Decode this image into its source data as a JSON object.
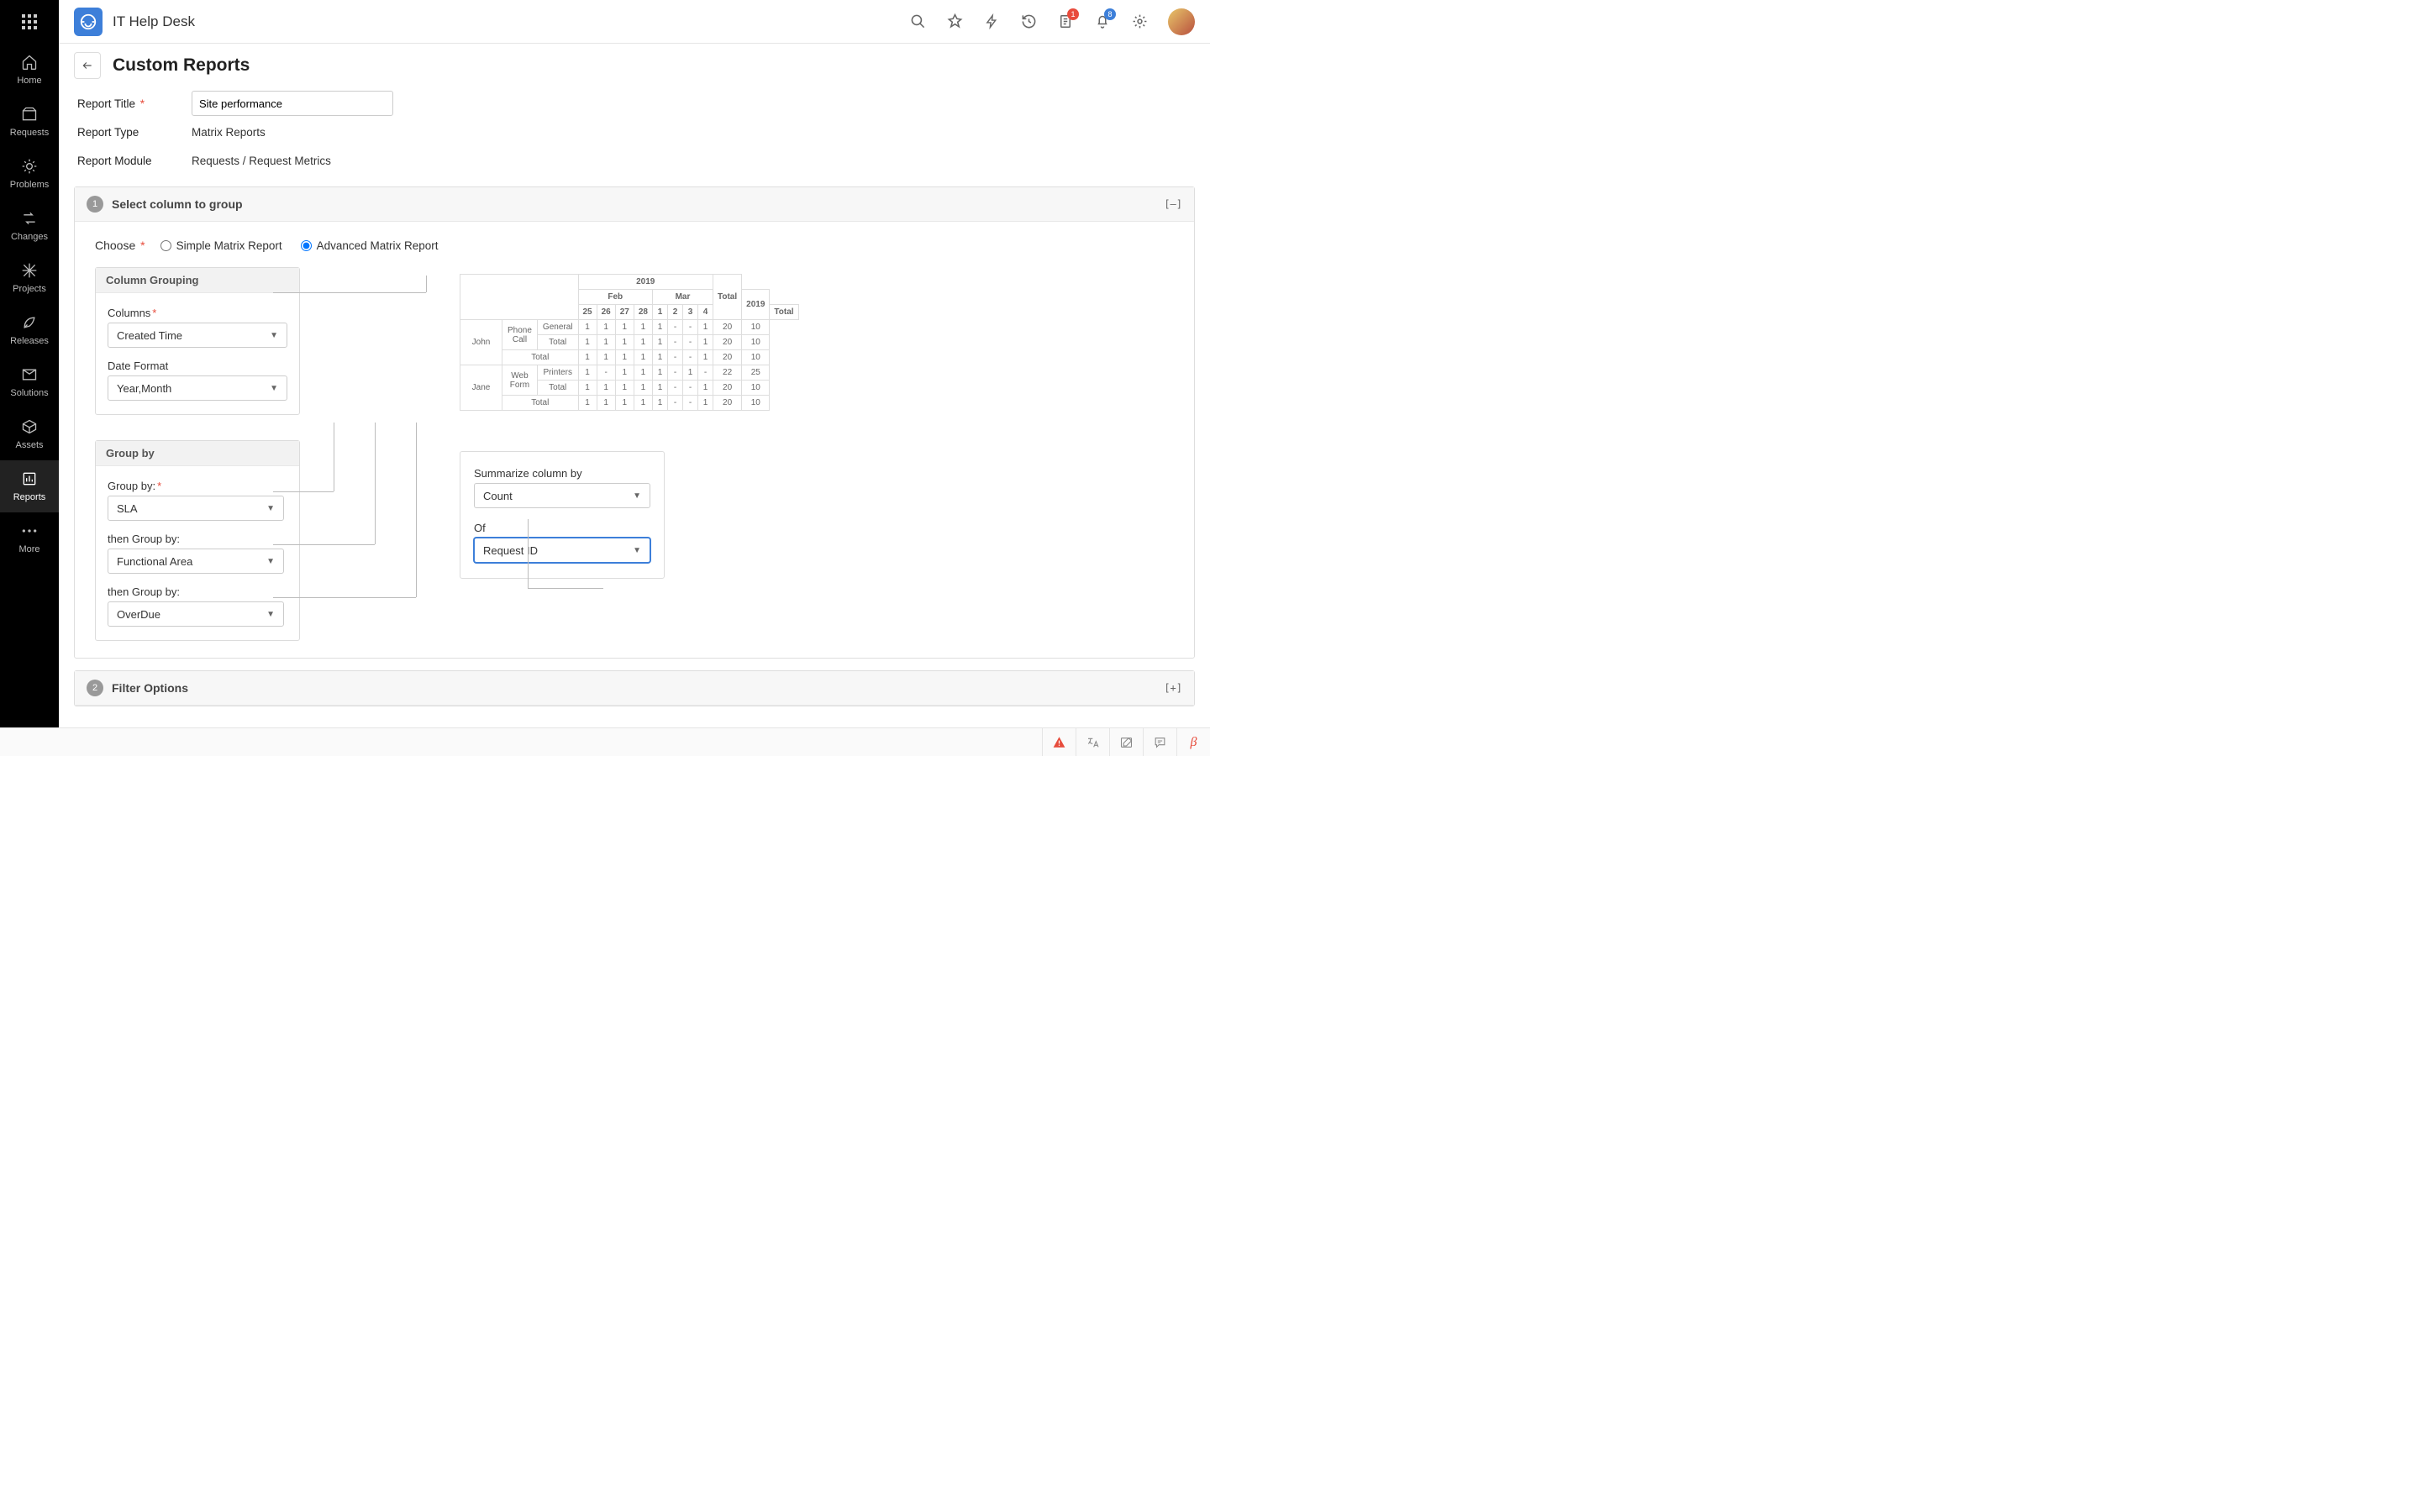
{
  "app": {
    "title": "IT Help Desk"
  },
  "nav": {
    "items": [
      {
        "label": "Home"
      },
      {
        "label": "Requests"
      },
      {
        "label": "Problems"
      },
      {
        "label": "Changes"
      },
      {
        "label": "Projects"
      },
      {
        "label": "Releases"
      },
      {
        "label": "Solutions"
      },
      {
        "label": "Assets"
      },
      {
        "label": "Reports"
      },
      {
        "label": "More"
      }
    ]
  },
  "topbar": {
    "clipboard_badge": "1",
    "bell_badge": "8"
  },
  "page": {
    "title": "Custom Reports",
    "report_title_label": "Report Title",
    "report_title_value": "Site performance",
    "report_type_label": "Report Type",
    "report_type_value": "Matrix Reports",
    "report_module_label": "Report Module",
    "report_module_value": "Requests / Request Metrics"
  },
  "section1": {
    "step": "1",
    "title": "Select column to group",
    "toggle": "[–]",
    "choose_label": "Choose",
    "radio_simple": "Simple Matrix Report",
    "radio_advanced": "Advanced Matrix Report",
    "column_grouping": {
      "header": "Column Grouping",
      "columns_label": "Columns",
      "columns_value": "Created Time",
      "date_format_label": "Date Format",
      "date_format_value": "Year,Month"
    },
    "group_by": {
      "header": "Group by",
      "label1": "Group by:",
      "value1": "SLA",
      "label2": "then Group by:",
      "value2": "Functional Area",
      "label3": "then Group by:",
      "value3": "OverDue"
    },
    "summarize": {
      "label1": "Summarize column by",
      "value1": "Count",
      "label2": "Of",
      "value2": "Request ID"
    },
    "preview": {
      "year": "2019",
      "total": "Total",
      "months": [
        "Feb",
        "Mar",
        "2019"
      ],
      "feb_days": [
        "25",
        "26",
        "27",
        "28"
      ],
      "mar_days": [
        "1",
        "2",
        "3",
        "4"
      ],
      "col_total": "Total",
      "rows": [
        {
          "g1": "John",
          "g2": "Phone Call",
          "g3": "General",
          "cells": [
            "1",
            "1",
            "1",
            "1",
            "1",
            "-",
            "-",
            "1",
            "20",
            "10"
          ]
        },
        {
          "g1": "",
          "g2": "",
          "g3": "Total",
          "cells": [
            "1",
            "1",
            "1",
            "1",
            "1",
            "-",
            "-",
            "1",
            "20",
            "10"
          ]
        },
        {
          "g1": "",
          "g2": "Total",
          "g3": "",
          "cells": [
            "1",
            "1",
            "1",
            "1",
            "1",
            "-",
            "-",
            "1",
            "20",
            "10"
          ]
        },
        {
          "g1": "Jane",
          "g2": "Web Form",
          "g3": "Printers",
          "cells": [
            "1",
            "-",
            "1",
            "1",
            "1",
            "-",
            "1",
            "-",
            "22",
            "25"
          ]
        },
        {
          "g1": "",
          "g2": "",
          "g3": "Total",
          "cells": [
            "1",
            "1",
            "1",
            "1",
            "1",
            "-",
            "-",
            "1",
            "20",
            "10"
          ]
        },
        {
          "g1": "",
          "g2": "Total",
          "g3": "",
          "cells": [
            "1",
            "1",
            "1",
            "1",
            "1",
            "-",
            "-",
            "1",
            "20",
            "10"
          ]
        }
      ]
    }
  },
  "section2": {
    "step": "2",
    "title": "Filter Options",
    "toggle": "[+]"
  },
  "statusbar": {
    "beta": "β"
  }
}
